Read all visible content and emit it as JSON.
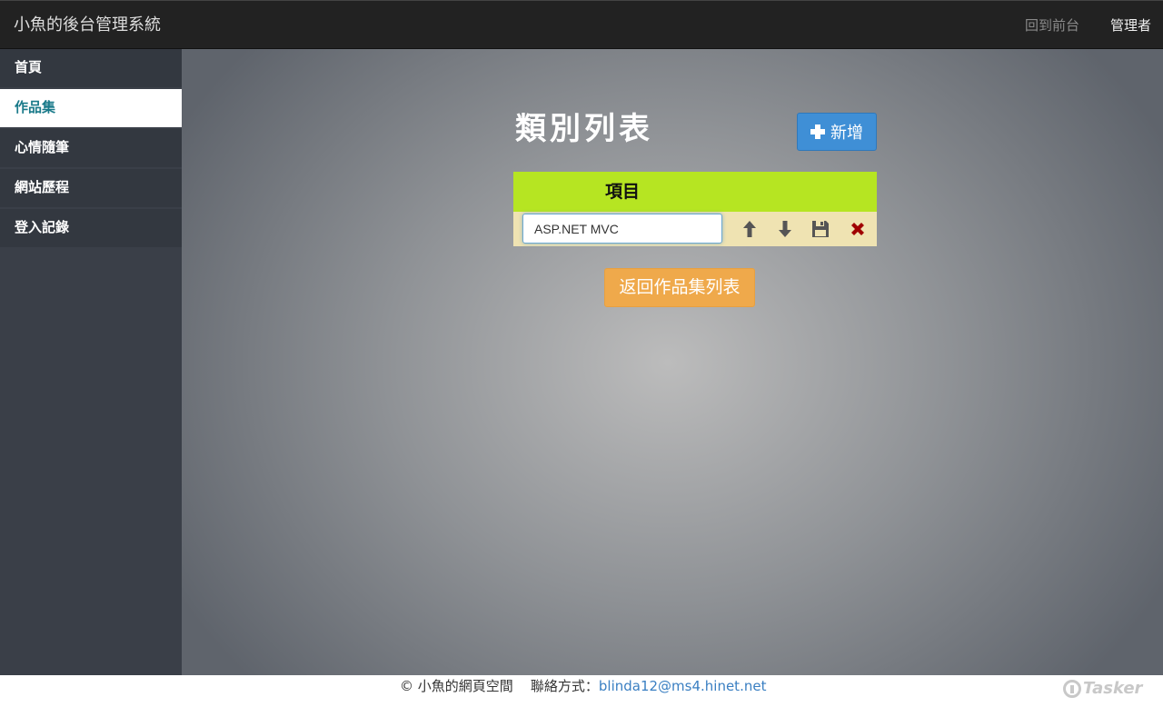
{
  "header": {
    "brand": "小魚的後台管理系統",
    "front_link": "回到前台",
    "user_label": "管理者"
  },
  "sidebar": {
    "items": [
      {
        "label": "首頁",
        "active": false
      },
      {
        "label": "作品集",
        "active": true
      },
      {
        "label": "心情隨筆",
        "active": false
      },
      {
        "label": "網站歷程",
        "active": false
      },
      {
        "label": "登入記錄",
        "active": false
      }
    ]
  },
  "main": {
    "title": "類別列表",
    "add_label": "新增",
    "table": {
      "column_header": "項目",
      "rows": [
        {
          "value": "ASP.NET MVC"
        }
      ]
    },
    "back_label": "返回作品集列表"
  },
  "footer": {
    "copyright": "© 小魚的網頁空間",
    "contact_label": "聯絡方式：",
    "contact_email": "blinda12@ms4.hinet.net",
    "watermark": "Tasker"
  },
  "icons": {
    "add": "plus-icon",
    "move_up": "arrow-up-icon",
    "move_down": "arrow-down-icon",
    "save": "floppy-disk-icon",
    "delete": "close-icon"
  },
  "colors": {
    "primary": "#3f8fd6",
    "warning": "#efa94b",
    "table_header": "#b6e522",
    "row_background": "#efe3b2",
    "delete": "#a00000",
    "active_nav_text": "#1a7a8a",
    "link": "#3a7fc2"
  }
}
